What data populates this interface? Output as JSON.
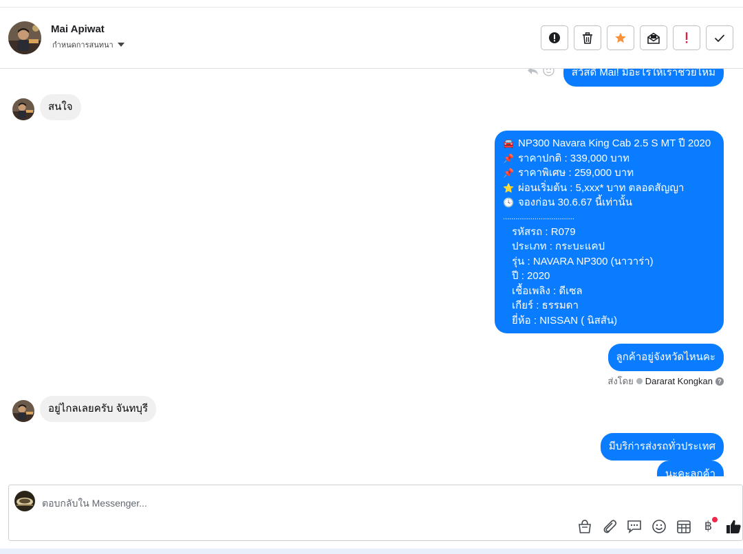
{
  "contact": {
    "name": "Mai Apiwat",
    "assign_label": "กำหนดการสนทนา"
  },
  "actions": [
    {
      "id": "spam",
      "icon": "alert-circle-icon"
    },
    {
      "id": "delete",
      "icon": "trash-icon"
    },
    {
      "id": "star",
      "icon": "star-icon",
      "color": "#f7923b"
    },
    {
      "id": "mark-unread",
      "icon": "envelope-icon"
    },
    {
      "id": "important",
      "icon": "exclamation-icon",
      "color": "#e41e3f"
    },
    {
      "id": "done",
      "icon": "checkmark-icon"
    }
  ],
  "messages": {
    "greeting": "สวัสดี Mai! มีอะไรให้เราช่วยไหม",
    "in_interest": "สนใจ",
    "car_details": {
      "line1": "NP300 Navara King Cab 2.5 S MT ปี 2020",
      "line2": "ราคาปกติ : 339,000 บาท",
      "line3": "ราคาพิเศษ : 259,000 บาท",
      "line4": "ผ่อนเริ่มต้น : 5,xxx* บาท ตลอดสัญญา",
      "line5": "จองก่อน 30.6.67 นี้เท่านั้น",
      "separator": "..................................",
      "code": "รหัสรถ : R079",
      "type": "ประเภท : กระบะแคป",
      "model": "รุ่น : NAVARA NP300 (นาวาร่า)",
      "year": "ปี : 2020",
      "fuel": "เชื้อเพลิง : ดีเซล",
      "gear": "เกียร์ : ธรรมดา",
      "brand": "ยี่ห้อ : NISSAN ( นิสสัน)"
    },
    "ask_province": "ลูกค้าอยู่จังหวัดไหนคะ",
    "sent_by_label": "ส่งโดย",
    "sent_by_name": "Dararat Kongkan",
    "in_far": "อยู่ไกลเลยครับ จันทบุรี",
    "delivery": "มีบริก่ารส่งรถทั่วประเทศ",
    "partial_last": "นะคะลูกค้า"
  },
  "composer": {
    "placeholder": "ตอบกลับใน Messenger..."
  },
  "colors": {
    "bubble_out": "#0a7cff",
    "bubble_in": "#f0f0f0",
    "accent": "#0a7cff"
  }
}
